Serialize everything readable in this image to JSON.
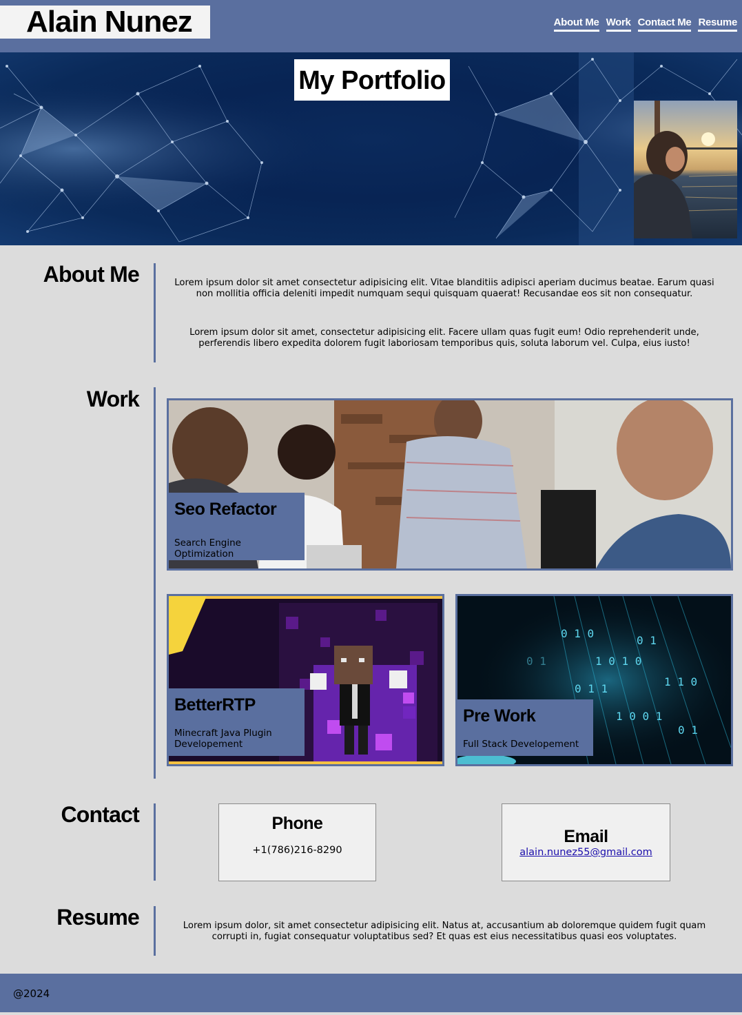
{
  "header": {
    "brand": "Alain Nunez",
    "nav": [
      "About Me",
      "Work",
      "Contact Me",
      "Resume"
    ]
  },
  "hero": {
    "title": "My Portfolio"
  },
  "about": {
    "label": "About Me",
    "p1": "Lorem ipsum dolor sit amet consectetur adipisicing elit. Vitae blanditiis adipisci aperiam ducimus beatae. Earum quasi non mollitia officia deleniti impedit numquam sequi quisquam quaerat! Recusandae eos sit non consequatur.",
    "p2": "Lorem ipsum dolor sit amet, consectetur adipisicing elit. Facere ullam quas fugit eum! Odio reprehenderit unde, perferendis libero expedita dolorem fugit laboriosam temporibus quis, soluta laborum vel. Culpa, eius iusto!"
  },
  "work": {
    "label": "Work",
    "cards": [
      {
        "title": "Seo Refactor",
        "desc": "Search Engine Optimization"
      },
      {
        "title": "BetterRTP",
        "desc": "Minecraft Java Plugin Developement"
      },
      {
        "title": "Pre Work",
        "desc": "Full Stack Developement"
      }
    ]
  },
  "contact": {
    "label": "Contact",
    "phone_heading": "Phone",
    "phone": "+1(786)216-8290",
    "email_heading": "Email",
    "email": "alain.nunez55@gmail.com"
  },
  "resume": {
    "label": "Resume",
    "text": "Lorem ipsum dolor, sit amet consectetur adipisicing elit. Natus at, accusantium ab doloremque quidem fugit quam corrupti in, fugiat consequatur voluptatibus sed? Et quas est eius necessitatibus quasi eos voluptates."
  },
  "footer": {
    "text": "@2024"
  },
  "colors": {
    "accent": "#5a6f9f",
    "page_bg": "#dcdcdc",
    "hero_bg": "#082454"
  }
}
